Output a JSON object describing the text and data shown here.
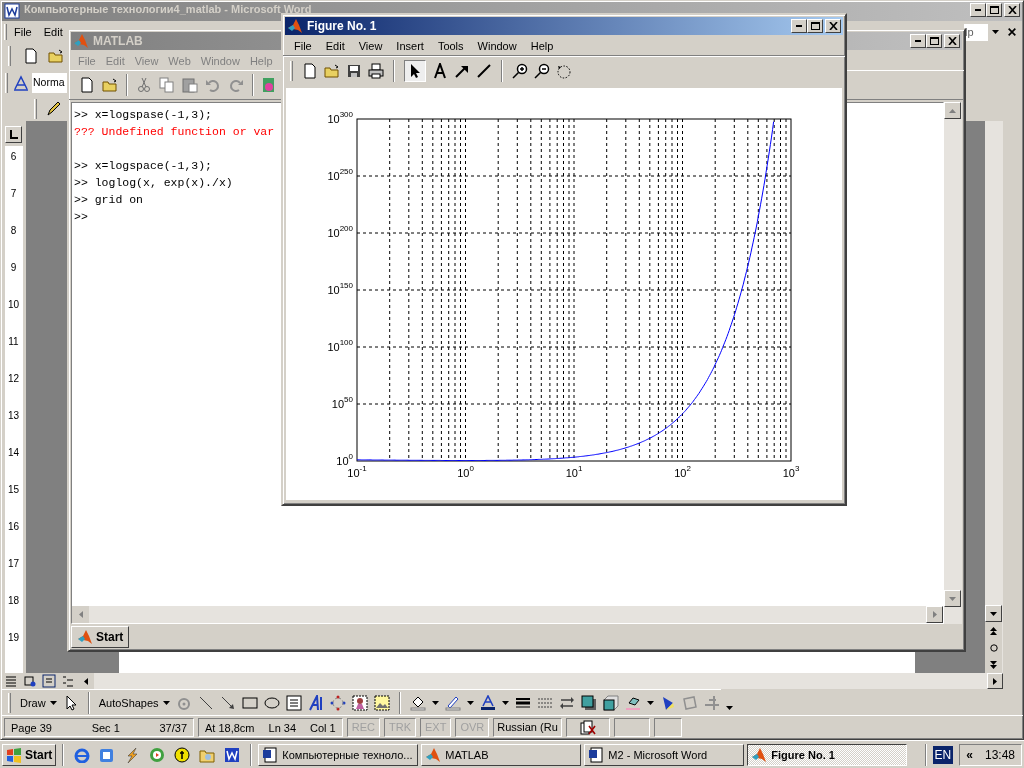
{
  "word": {
    "title": "Компьютерные технологии4_matlab - Microsoft Word",
    "active": false,
    "menu": [
      "File",
      "Edit"
    ],
    "help_box": "lp",
    "style_box": "Norma",
    "ruler": [
      "6",
      "7",
      "8",
      "9",
      "10",
      "11",
      "12",
      "13",
      "14",
      "15",
      "16",
      "17",
      "18",
      "19"
    ],
    "draw_toolbar": [
      "Draw",
      "AutoShapes"
    ],
    "status_bar": [
      {
        "kind": "group",
        "items": [
          "Page 39",
          "Sec 1",
          "37/37"
        ]
      },
      {
        "kind": "group",
        "items": [
          "At 18,8cm",
          "Ln 34",
          "Col 1"
        ]
      },
      {
        "kind": "mode",
        "text": "REC",
        "disabled": true
      },
      {
        "kind": "mode",
        "text": "TRK",
        "disabled": true
      },
      {
        "kind": "mode",
        "text": "EXT",
        "disabled": true
      },
      {
        "kind": "mode",
        "text": "OVR",
        "disabled": true
      },
      {
        "kind": "language",
        "text": "Russian (Ru"
      }
    ]
  },
  "matlab": {
    "title": "MATLAB",
    "active": false,
    "menu": [
      {
        "label": "File",
        "disabled": true
      },
      {
        "label": "Edit",
        "disabled": true
      },
      {
        "label": "View",
        "disabled": true
      },
      {
        "label": "Web",
        "disabled": true
      },
      {
        "label": "Window",
        "disabled": true
      },
      {
        "label": "Help",
        "disabled": true
      }
    ],
    "console": [
      {
        "kind": "command",
        "text": ">> x=logspase(-1,3);"
      },
      {
        "kind": "error",
        "text": "??? Undefined function or var"
      },
      {
        "kind": "blank"
      },
      {
        "kind": "command",
        "text": ">> x=logspace(-1,3);"
      },
      {
        "kind": "command",
        "text": ">> loglog(x, exp(x)./x)"
      },
      {
        "kind": "command",
        "text": ">> grid on"
      },
      {
        "kind": "command",
        "text": ">>"
      }
    ],
    "start_button": "Start"
  },
  "figure": {
    "title": "Figure No. 1",
    "active": true,
    "menu": [
      "File",
      "Edit",
      "View",
      "Insert",
      "Tools",
      "Window",
      "Help"
    ],
    "plot": {
      "x_tick_labels": [
        "10$^{-1}$",
        "10$^{0}$",
        "10$^{1}$",
        "10$^{2}$",
        "10$^{3}$"
      ],
      "y_tick_labels": [
        "10$^{300}$",
        "10$^{250}$",
        "10$^{200}$",
        "10$^{150}$",
        "10$^{100}$",
        "10$^{50}$",
        "10$^{0}$"
      ]
    }
  },
  "taskbar": {
    "start": "Start",
    "tasks": [
      {
        "label": "Компьютерные техноло...",
        "selected": false,
        "kind": "word"
      },
      {
        "label": "MATLAB",
        "selected": false,
        "kind": "matlab"
      },
      {
        "label": "M2 - Microsoft Word",
        "selected": false,
        "kind": "word"
      },
      {
        "label": "Figure No. 1",
        "selected": true,
        "kind": "figure"
      }
    ],
    "language": "EN",
    "tray_toggle": "«",
    "clock": "13:48"
  }
}
